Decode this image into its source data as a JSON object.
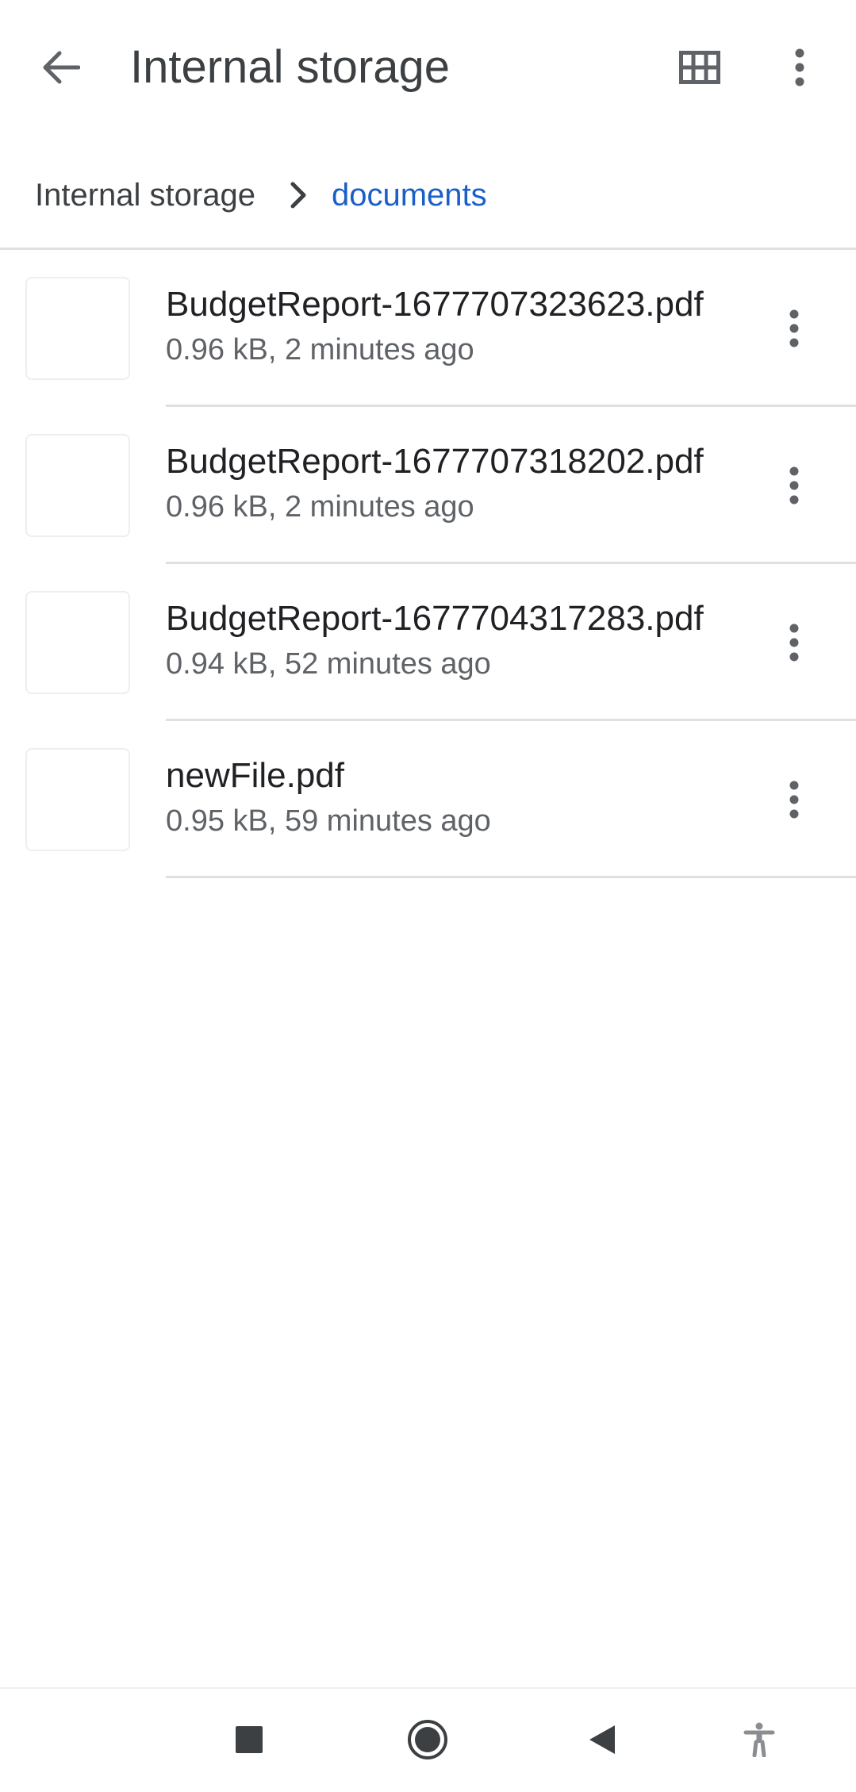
{
  "appbar": {
    "title": "Internal storage",
    "back_icon": "arrow-back-icon",
    "grid_icon": "grid-view-icon",
    "more_icon": "more-vert-icon"
  },
  "breadcrumb": {
    "root": "Internal storage",
    "separator_icon": "chevron-right-icon",
    "current": "documents",
    "current_color": "#1a5fc9"
  },
  "files": [
    {
      "name": "BudgetReport-1677707323623.pdf",
      "meta": "0.96 kB, 2 minutes ago"
    },
    {
      "name": "BudgetReport-1677707318202.pdf",
      "meta": "0.96 kB, 2 minutes ago"
    },
    {
      "name": "BudgetReport-1677704317283.pdf",
      "meta": "0.94 kB, 52 minutes ago"
    },
    {
      "name": "newFile.pdf",
      "meta": "0.95 kB, 59 minutes ago"
    }
  ],
  "navbar": {
    "recents_icon": "square-recents-icon",
    "home_icon": "circle-home-icon",
    "back_icon": "triangle-back-icon",
    "accessibility_icon": "accessibility-icon"
  }
}
